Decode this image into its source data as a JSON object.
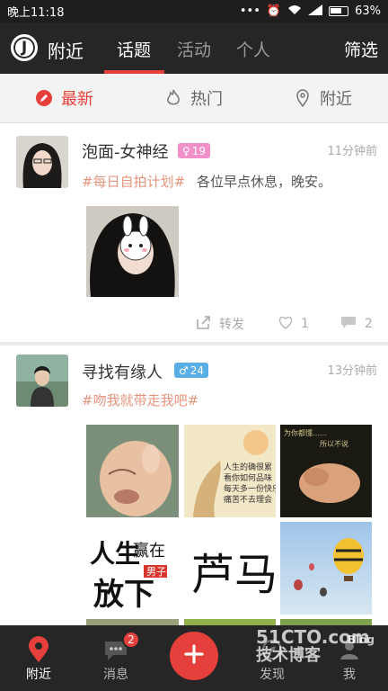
{
  "status_bar": {
    "time": "晚上11:18",
    "battery": "63%"
  },
  "header": {
    "logo_letter": "J",
    "location_title": "附近",
    "tabs": [
      {
        "label": "话题",
        "active": true
      },
      {
        "label": "活动",
        "active": false
      },
      {
        "label": "个人",
        "active": false
      }
    ],
    "filter_label": "筛选"
  },
  "sub_tabs": [
    {
      "label": "最新",
      "icon": "pencil-icon",
      "active": true
    },
    {
      "label": "热门",
      "icon": "flame-icon",
      "active": false
    },
    {
      "label": "附近",
      "icon": "location-pin-icon",
      "active": false
    }
  ],
  "posts": [
    {
      "author": "泡面-女神经",
      "gender_icon": "female-icon",
      "age": "19",
      "badge_color": "#f08fc8",
      "time": "11分钟前",
      "topic_tag": "#每日自拍计划#",
      "text": "各位早点休息，晚安。",
      "actions": {
        "repost_label": "转发",
        "like_count": "1",
        "comment_count": "2"
      }
    },
    {
      "author": "寻找有缘人",
      "gender_icon": "male-icon",
      "age": "24",
      "badge_color": "#5aaee6",
      "time": "13分钟前",
      "topic_tag": "#吻我就带走我吧#",
      "image_texts": [
        "人生的确很累\n看你如何品味\n每天多一份快乐\n痛苦不去理会",
        "为你都懂……所以不说",
        "人生赢在放下 男子",
        "芦马"
      ]
    }
  ],
  "bottom_nav": [
    {
      "label": "附近",
      "icon": "location-pin-icon",
      "active": true
    },
    {
      "label": "消息",
      "icon": "chat-bubble-icon",
      "active": false,
      "badge": "2"
    },
    {
      "label": "发现",
      "icon": "compass-icon",
      "active": false
    },
    {
      "label": "我",
      "icon": "user-icon",
      "active": false
    }
  ],
  "watermark": {
    "site": "51CTO.com",
    "subtitle": "技术博客",
    "blog": "Blog"
  },
  "colors": {
    "accent": "#e5403b",
    "dark_bar": "#262626",
    "tag": "#e8937e"
  }
}
